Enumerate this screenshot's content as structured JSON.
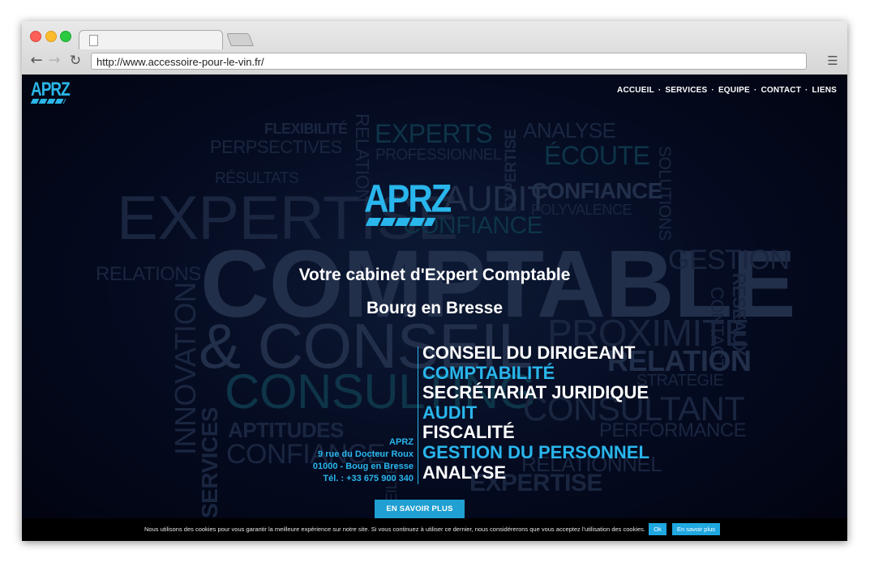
{
  "browser": {
    "url": "http://www.accessoire-pour-le-vin.fr/",
    "back_glyph": "←",
    "forward_glyph": "→",
    "reload_glyph": "↻",
    "menu_glyph": "☰"
  },
  "site": {
    "logo_text": "APRZ",
    "nav": [
      "ACCUEIL",
      "SERVICES",
      "EQUIPE",
      "CONTACT",
      "LIENS"
    ],
    "nav_separator": "·",
    "hero_logo_text": "APRZ",
    "tagline_line1": "Votre cabinet d'Expert Comptable",
    "tagline_line2": "Bourg en Bresse",
    "services": [
      {
        "text": "CONSEIL DU DIRIGEANT",
        "color": "white"
      },
      {
        "text": "COMPTABILITÉ",
        "color": "blue"
      },
      {
        "text": "SECRÉTARIAT JURIDIQUE",
        "color": "white"
      },
      {
        "text": "AUDIT",
        "color": "blue"
      },
      {
        "text": "FISCALITÉ",
        "color": "white"
      },
      {
        "text": "GESTION DU PERSONNEL",
        "color": "blue"
      },
      {
        "text": "ANALYSE",
        "color": "white"
      }
    ],
    "address": {
      "name": "APRZ",
      "street": "9 rue du Docteur Roux",
      "city": "01000 - Boug en Bresse",
      "phone": "Tél. : +33 675 900 340"
    },
    "cta_label": "EN SAVOIR PLUS",
    "cookie": {
      "text": "Nous utilisons des cookies pour vous garantir la meilleure expérience sur notre site. Si vous continuez à utiliser ce dernier, nous considérerons que vous acceptez l'utilisation des cookies.",
      "ok_label": "Ok",
      "more_label": "En savoir plus"
    },
    "word_cloud": {
      "flexibilite": "FLEXIBILITÉ",
      "perspectives": "PERPSECTIVES",
      "resultats": "RÉSULTATS",
      "expertise_big": "EXPERTISE",
      "relations": "RELATIONS",
      "relation_v": "RELATION",
      "experts": "EXPERTS",
      "professionnel": "PROFESSIONNEL",
      "expertise_v": "EXPERTISE",
      "analyse": "ANALYSE",
      "ecoute": "ÉCOUTE",
      "solutions": "SOLUTIONS",
      "audit": "AUDIT",
      "confiance": "CONFIANCE",
      "polyvalence": "POLYVALENCE",
      "confiance_mid": "CONFIANCE",
      "comptable": "COMPTABLE",
      "gestion": "GESTION",
      "reseaux": "RESEAUX",
      "contact": "CONTACT",
      "conseil": "& CONSEIL",
      "proximite": "PROXIMITÉ",
      "relation2": "RELATION",
      "strategie": "STRATEGIE",
      "innovation": "INNOVATION",
      "consulting": "CONSULTING",
      "services": "SERVICES",
      "aptitudes": "APTITUDES",
      "confiance_low": "CONFIANCE",
      "consultant": "CONSULTANT",
      "performance": "PERFORMANCE",
      "relationnel": "RELATIONNEL",
      "expertise_low": "EXPERTISE",
      "veille": "VEILLE"
    }
  }
}
